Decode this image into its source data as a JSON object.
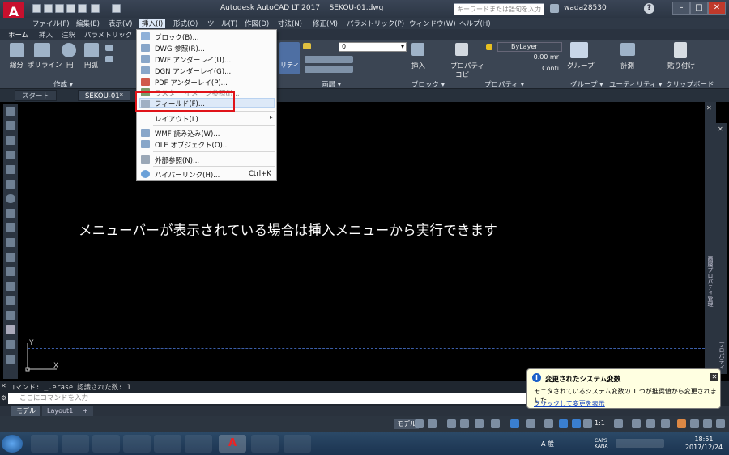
{
  "app": {
    "title": "Autodesk AutoCAD LT 2017",
    "filename": "SEKOU-01.dwg",
    "search_placeholder": "キーワードまたは語句を入力",
    "user": "wada28530"
  },
  "menubar": [
    "ファイル(F)",
    "編集(E)",
    "表示(V)",
    "挿入(I)",
    "形式(O)",
    "ツール(T)",
    "作図(D)",
    "寸法(N)",
    "修正(M)",
    "パラメトリック(P)",
    "ウィンドウ(W)",
    "ヘルプ(H)"
  ],
  "ribbon_tabs": [
    "ホーム",
    "挿入",
    "注釈",
    "パラメトリック"
  ],
  "ribbon": {
    "tools": [
      "線分",
      "ポリライン",
      "円",
      "円弧"
    ],
    "panel_draw": "作成",
    "layer_value": "0",
    "panel_layer": "画層",
    "insert_label": "挿入",
    "panel_block": "ブロック",
    "prop_label": "プロパティ",
    "copy_label": "コピー",
    "bylayer": "ByLayer",
    "lineweight": "0.00 mr",
    "linetype": "Conti",
    "panel_props": "プロパティ",
    "group_label": "グループ",
    "panel_group": "グループ",
    "measure_label": "計測",
    "panel_util": "ユーティリティ",
    "paste_label": "貼り付け",
    "panel_clip": "クリップボード",
    "prop_partial": "リティ"
  },
  "doc_tabs": [
    "スタート",
    "SEKOU-01*"
  ],
  "insert_menu": {
    "items": [
      "ブロック(B)...",
      "DWG 参照(R)...",
      "DWF アンダーレイ(U)...",
      "DGN アンダーレイ(G)...",
      "PDF アンダーレイ(P)...",
      "ラスター イメージ参照(I)...",
      "フィールド(F)...",
      "レイアウト(L)",
      "WMF 読み込み(W)...",
      "OLE オブジェクト(O)...",
      "外部参照(N)...",
      "ハイパーリンク(H)..."
    ],
    "hyperlink_shortcut": "Ctrl+K",
    "submenu_arrow": "▸"
  },
  "canvas": {
    "overlay_text": "メニューバーが表示されている場合は挿入メニューから実行できます",
    "ucs_y": "Y",
    "ucs_x": "X"
  },
  "right_palette_label": "画層プロパティ管理",
  "right_palette2_label": "プロパティ",
  "command": {
    "history": "コマンド: _.erase 認識された数: 1",
    "placeholder": "ここにコマンドを入力"
  },
  "layout_tabs": [
    "モデル",
    "Layout1",
    "+"
  ],
  "status": {
    "model": "モデル",
    "scale": "1:1"
  },
  "balloon": {
    "title": "変更されたシステム変数",
    "message": "モニタされているシステム変数の 1 つが推奨値から変更されました",
    "link": "クリックして変更を表示"
  },
  "taskbar": {
    "ime": "A 般",
    "caps": "CAPS KANA",
    "time": "18:51",
    "date": "2017/12/24"
  },
  "colors": {
    "accent": "#c8102e",
    "highlight": "#e0141a",
    "canvas": "#000000"
  }
}
